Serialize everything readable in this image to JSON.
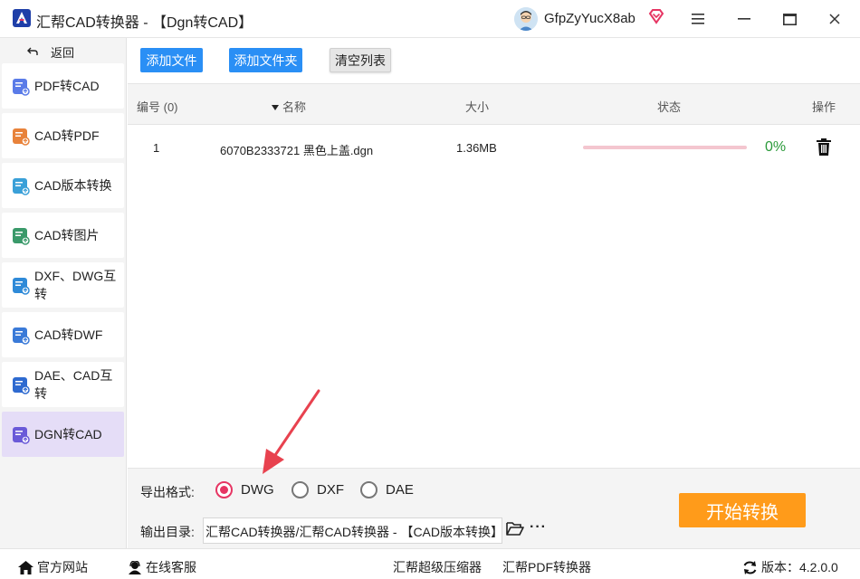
{
  "app": {
    "title": "汇帮CAD转换器 - 【Dgn转CAD】",
    "username": "GfpZyYucX8ab",
    "logo_icon": "app-logo-icon",
    "brand_color": "#2a8ff5"
  },
  "window_controls": {
    "menu_icon": "☰",
    "minimize_icon": "—",
    "maximize_icon": "▭",
    "close_icon": "✕"
  },
  "sidebar": {
    "back_label": "返回",
    "items": [
      {
        "label": "PDF转CAD",
        "icon": "pdf-to-cad-icon"
      },
      {
        "label": "CAD转PDF",
        "icon": "cad-to-pdf-icon"
      },
      {
        "label": "CAD版本转换",
        "icon": "cad-version-icon"
      },
      {
        "label": "CAD转图片",
        "icon": "cad-to-image-icon"
      },
      {
        "label": "DXF、DWG互转",
        "icon": "dxf-dwg-icon"
      },
      {
        "label": "CAD转DWF",
        "icon": "cad-to-dwf-icon"
      },
      {
        "label": "DAE、CAD互转",
        "icon": "dae-cad-icon"
      },
      {
        "label": "DGN转CAD",
        "icon": "dgn-to-cad-icon",
        "active": true
      }
    ]
  },
  "toolbar": {
    "add_file": "添加文件",
    "add_folder": "添加文件夹",
    "clear_list": "清空列表"
  },
  "table": {
    "headers": {
      "index": "编号 (0)",
      "name": "名称",
      "size": "大小",
      "status": "状态",
      "action": "操作"
    },
    "rows": [
      {
        "index": "1",
        "name": "6070B2333721 黑色上盖.dgn",
        "size": "1.36MB",
        "progress": 0,
        "percent": "0%"
      }
    ]
  },
  "output": {
    "format_label": "导出格式:",
    "formats": [
      "DWG",
      "DXF",
      "DAE"
    ],
    "selected_format": "DWG",
    "dir_label": "输出目录:",
    "dir_value": "汇帮CAD转换器/汇帮CAD转换器 - 【CAD版本转换】",
    "more": "···",
    "start_button": "开始转换"
  },
  "statusbar": {
    "website": "官方网站",
    "support": "在线客服",
    "compressor": "汇帮超级压缩器",
    "pdf_converter": "汇帮PDF转换器",
    "version": "版本：4.2.0.0"
  }
}
